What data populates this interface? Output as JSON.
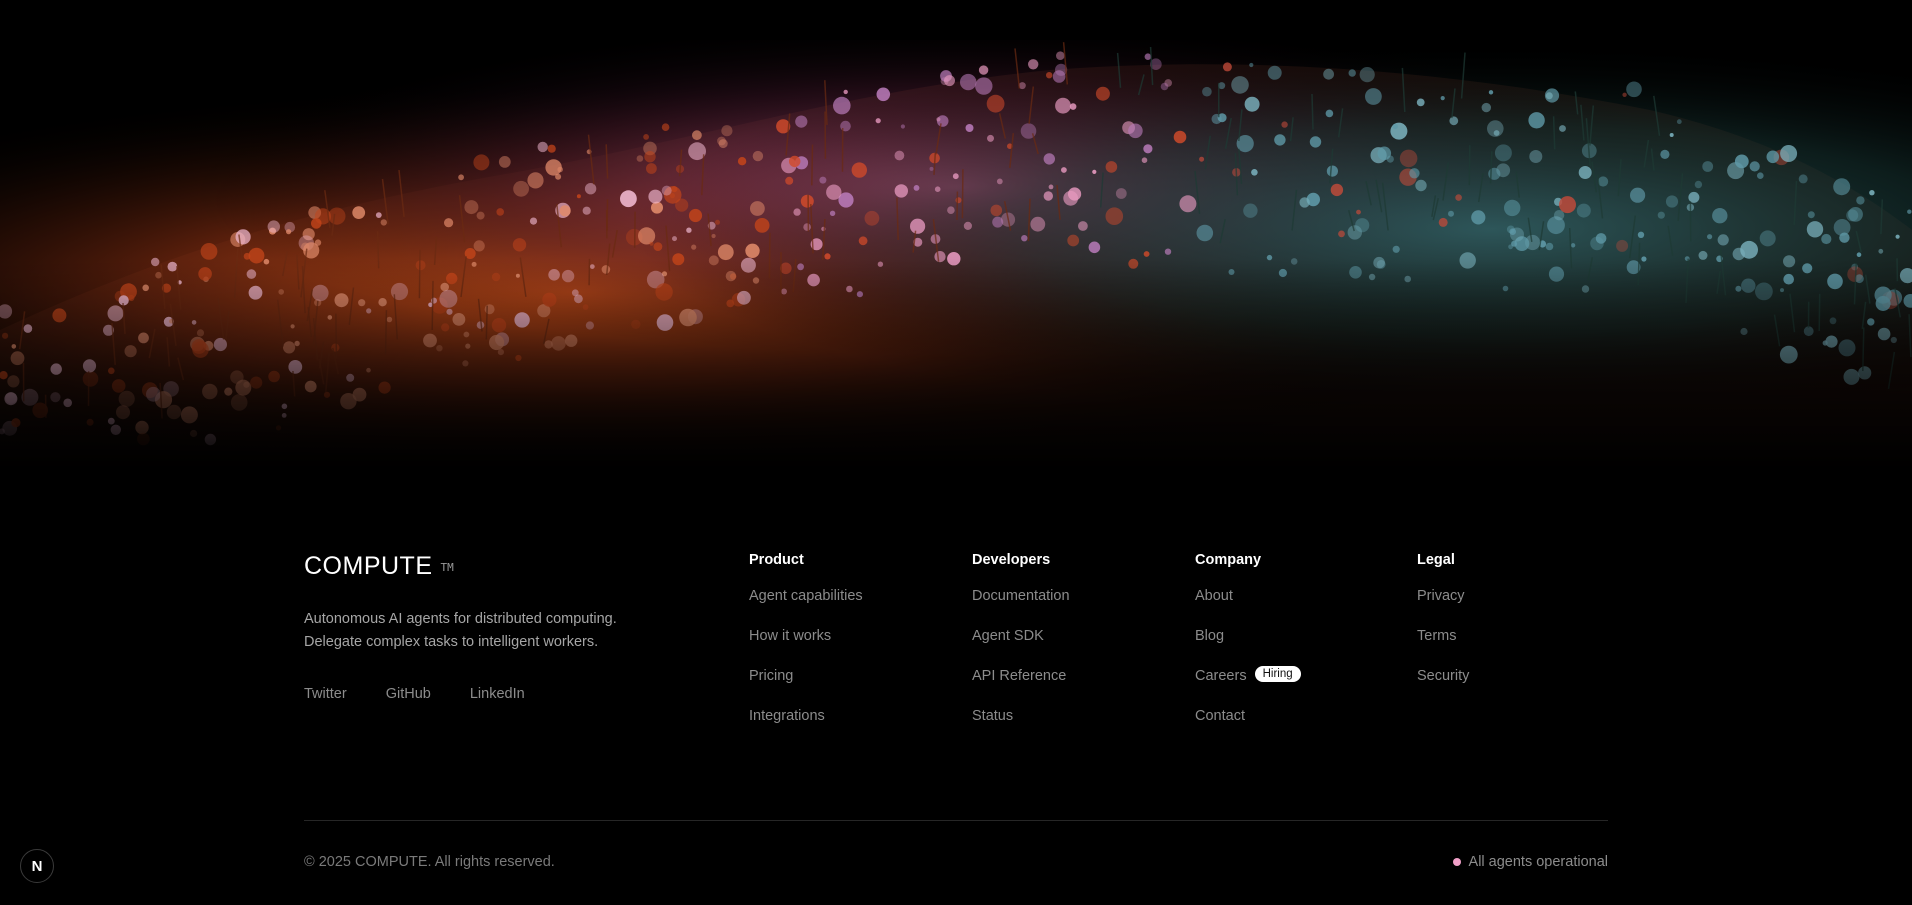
{
  "hero": {
    "image_description": "flower-meadow"
  },
  "brand": {
    "name": "COMPUTE",
    "tm": "TM",
    "tagline_line1": "Autonomous AI agents for distributed computing.",
    "tagline_line2": "Delegate complex tasks to intelligent workers."
  },
  "social": [
    "Twitter",
    "GitHub",
    "LinkedIn"
  ],
  "columns": [
    {
      "title": "Product",
      "links": [
        "Agent capabilities",
        "How it works",
        "Pricing",
        "Integrations"
      ]
    },
    {
      "title": "Developers",
      "links": [
        "Documentation",
        "Agent SDK",
        "API Reference",
        "Status"
      ]
    },
    {
      "title": "Company",
      "links": [
        "About",
        "Blog",
        "Careers",
        "Contact"
      ],
      "badge": "Hiring"
    },
    {
      "title": "Legal",
      "links": [
        "Privacy",
        "Terms",
        "Security"
      ]
    }
  ],
  "footer": {
    "copyright": "© 2025 COMPUTE. All rights reserved.",
    "status": "All agents operational",
    "status_color": "#f0a0c8"
  },
  "dev_badge": {
    "letter": "N"
  },
  "colors": {
    "background": "#000000",
    "muted_text": "#8c8c8c",
    "heading_text": "#ffffff"
  }
}
